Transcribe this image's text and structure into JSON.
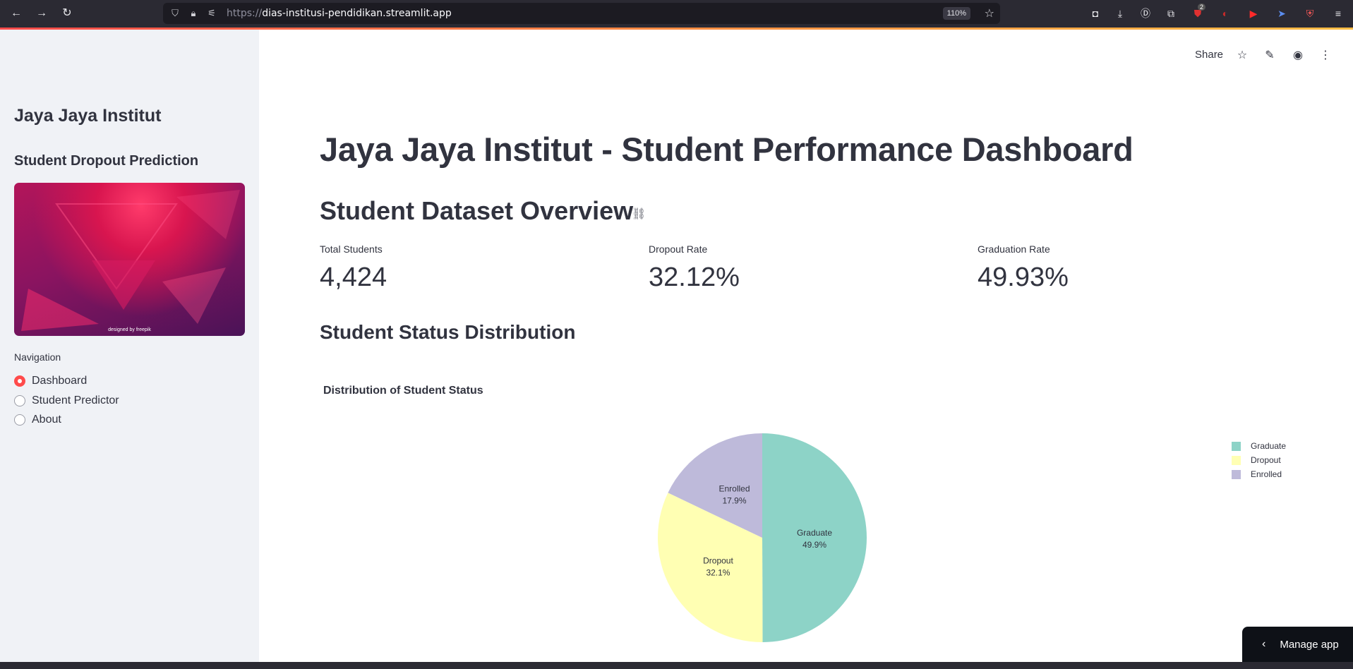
{
  "browser": {
    "url_protocol": "https://",
    "url_host": "dias-institusi-pendidikan.streamlit.app",
    "zoom": "110%",
    "extension_badge": "2"
  },
  "sidebar": {
    "title": "Jaya Jaya Institut",
    "subtitle": "Student Dropout Prediction",
    "image_credit": "designed by freepik",
    "nav_label": "Navigation",
    "nav_items": [
      {
        "label": "Dashboard",
        "selected": true
      },
      {
        "label": "Student Predictor",
        "selected": false
      },
      {
        "label": "About",
        "selected": false
      }
    ]
  },
  "header": {
    "share_label": "Share"
  },
  "main": {
    "title": "Jaya Jaya Institut - Student Performance Dashboard",
    "overview_heading": "Student Dataset Overview",
    "metrics": [
      {
        "label": "Total Students",
        "value": "4,424"
      },
      {
        "label": "Dropout Rate",
        "value": "32.12%"
      },
      {
        "label": "Graduation Rate",
        "value": "49.93%"
      }
    ],
    "distribution_heading": "Student Status Distribution"
  },
  "chart_data": {
    "type": "pie",
    "title": "Distribution of Student Status",
    "categories": [
      "Graduate",
      "Dropout",
      "Enrolled"
    ],
    "values": [
      49.9,
      32.1,
      17.9
    ],
    "value_labels": [
      "49.9%",
      "32.1%",
      "17.9%"
    ],
    "colors": [
      "#8dd3c7",
      "#ffffb3",
      "#bebada"
    ],
    "legend_position": "top-right"
  },
  "footer": {
    "manage_label": "Manage app"
  }
}
